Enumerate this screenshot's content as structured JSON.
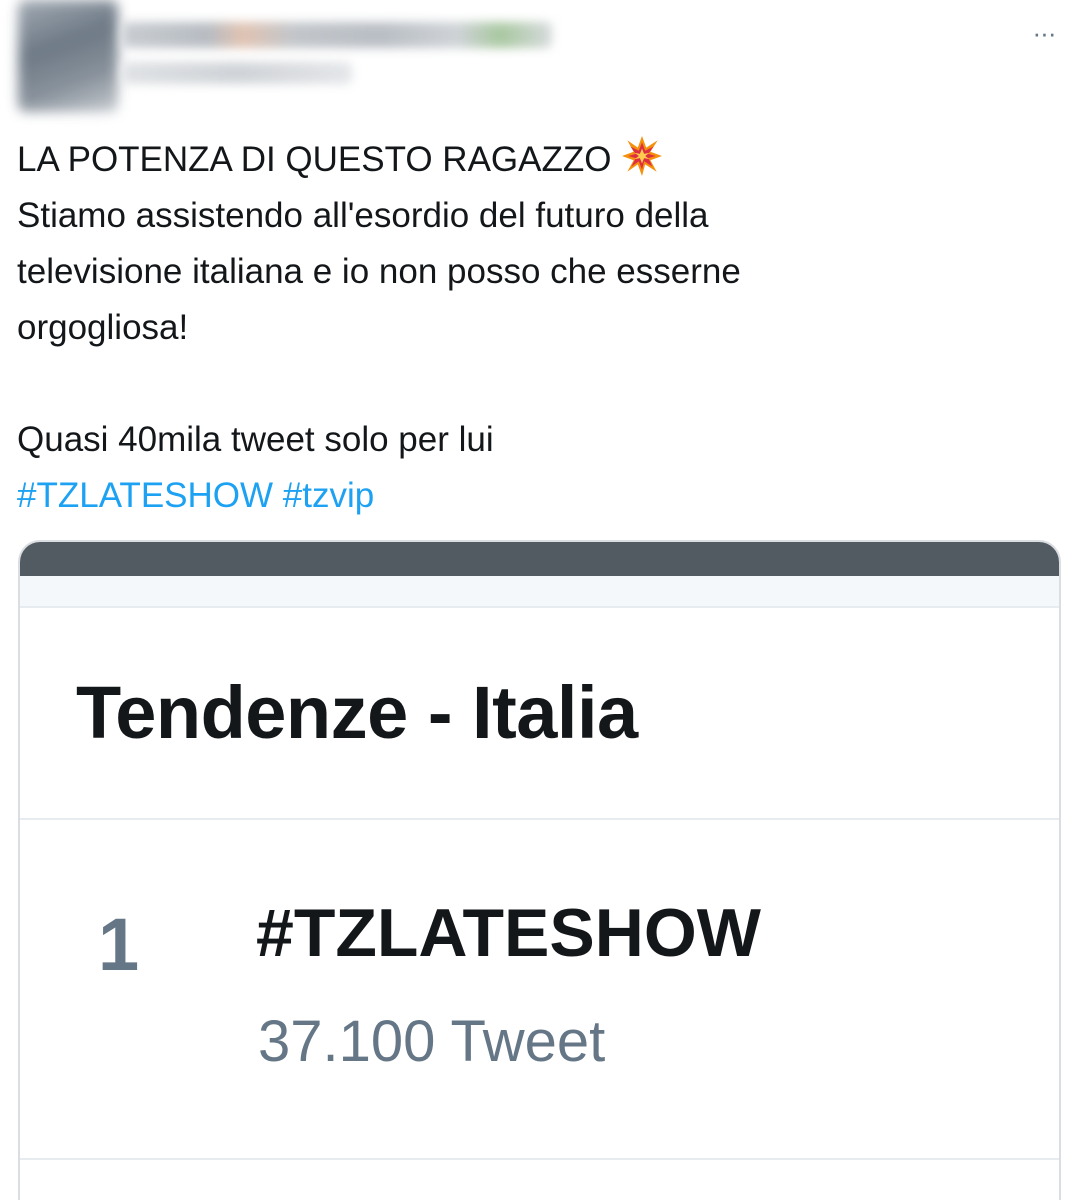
{
  "header": {
    "more_icon": "more-horizontal-icon",
    "more_glyph": "···"
  },
  "tweet": {
    "lines": [
      "LA POTENZA DI QUESTO RAGAZZO",
      "Stiamo assistendo all'esordio del futuro della",
      "televisione italiana e io non posso che esserne",
      "orgogliosa!",
      "Quasi 40mila tweet solo per lui"
    ],
    "emoji": "collision-emoji",
    "hashtags": [
      "#TZLATESHOW",
      "#tzvip"
    ]
  },
  "media": {
    "title": "Tendenze - Italia",
    "trends": [
      {
        "rank": "1",
        "name": "#TZLATESHOW",
        "count": "37.100 Tweet"
      }
    ]
  },
  "colors": {
    "text": "#14171a",
    "link": "#1da1f2",
    "secondary": "#657786",
    "bar": "#535b62"
  }
}
